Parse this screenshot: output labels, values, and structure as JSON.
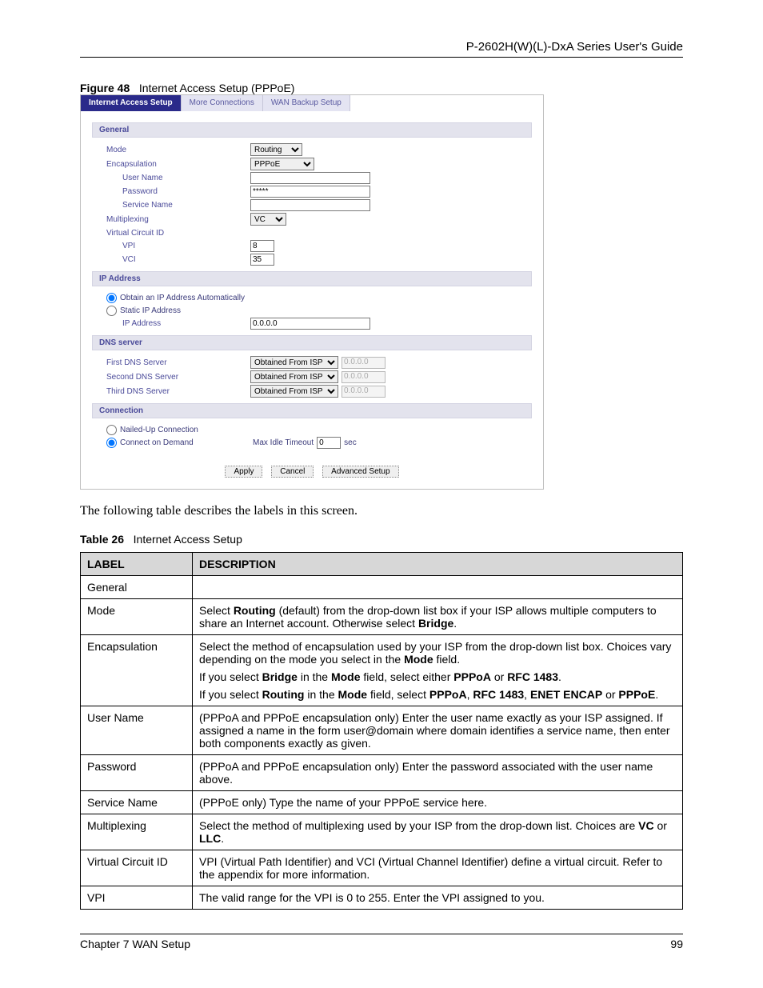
{
  "header": {
    "guide_title": "P-2602H(W)(L)-DxA Series User's Guide"
  },
  "figure": {
    "label": "Figure 48",
    "title": "Internet Access Setup (PPPoE)"
  },
  "shot": {
    "tabs": {
      "active": "Internet Access Setup",
      "t2": "More Connections",
      "t3": "WAN Backup Setup"
    },
    "general": {
      "header": "General",
      "mode_lbl": "Mode",
      "mode_val": "Routing",
      "encap_lbl": "Encapsulation",
      "encap_val": "PPPoE",
      "user_lbl": "User Name",
      "user_val": "",
      "pass_lbl": "Password",
      "pass_val": "*****",
      "service_lbl": "Service Name",
      "service_val": "",
      "mux_lbl": "Multiplexing",
      "mux_val": "VC",
      "vcid_lbl": "Virtual Circuit ID",
      "vpi_lbl": "VPI",
      "vpi_val": "8",
      "vci_lbl": "VCI",
      "vci_val": "35"
    },
    "ip": {
      "header": "IP Address",
      "auto_lbl": "Obtain an IP Address Automatically",
      "static_lbl": "Static IP Address",
      "addr_lbl": "IP Address",
      "addr_val": "0.0.0.0"
    },
    "dns": {
      "header": "DNS server",
      "d1_lbl": "First DNS Server",
      "mode": "Obtained From ISP",
      "val": "0.0.0.0",
      "d2_lbl": "Second DNS Server",
      "d3_lbl": "Third DNS Server"
    },
    "conn": {
      "header": "Connection",
      "nailed_lbl": "Nailed-Up Connection",
      "demand_lbl": "Connect on Demand",
      "idle_lbl": "Max Idle Timeout",
      "idle_val": "0",
      "idle_unit": "sec"
    },
    "buttons": {
      "apply": "Apply",
      "cancel": "Cancel",
      "adv": "Advanced Setup"
    }
  },
  "body_text": "The following table describes the labels in this screen.",
  "table_caption": {
    "label": "Table 26",
    "title": "Internet Access Setup"
  },
  "desc_table": {
    "h_label": "LABEL",
    "h_desc": "DESCRIPTION",
    "rows": [
      {
        "label": "General",
        "desc": [
          ""
        ]
      },
      {
        "label": "Mode",
        "desc": [
          "Select <b>Routing</b> (default) from the drop-down list box if your ISP allows multiple computers to share an Internet account. Otherwise select <b>Bridge</b>."
        ]
      },
      {
        "label": "Encapsulation",
        "desc": [
          "Select the method of encapsulation used by your ISP from the drop-down list box. Choices vary depending on the mode you select in the <b>Mode</b> field.",
          "If you select <b>Bridge</b> in the <b>Mode</b> field, select either <b>PPPoA</b> or <b>RFC 1483</b>.",
          "If you select <b>Routing</b> in the <b>Mode</b> field, select <b>PPPoA</b>, <b>RFC 1483</b>, <b>ENET ENCAP</b> or <b>PPPoE</b>."
        ]
      },
      {
        "label": "User Name",
        "desc": [
          "(PPPoA and PPPoE encapsulation only) Enter the user name exactly as your ISP assigned. If assigned a name in the form user@domain where domain identifies a service name, then enter both components exactly as given."
        ]
      },
      {
        "label": "Password",
        "desc": [
          "(PPPoA and PPPoE encapsulation only) Enter the password associated with the user name above."
        ]
      },
      {
        "label": "Service Name",
        "desc": [
          "(PPPoE only) Type the name of your PPPoE service here."
        ]
      },
      {
        "label": "Multiplexing",
        "desc": [
          "Select the method of multiplexing used by your ISP from the drop-down list. Choices are <b>VC</b> or <b>LLC</b>."
        ]
      },
      {
        "label": "Virtual Circuit ID",
        "desc": [
          "VPI (Virtual Path Identifier) and VCI (Virtual Channel Identifier) define a virtual circuit. Refer to the appendix for more information."
        ]
      },
      {
        "label": "VPI",
        "desc": [
          "The valid range for the VPI is 0 to 255. Enter the VPI assigned to you."
        ]
      }
    ]
  },
  "footer": {
    "chapter": "Chapter 7 WAN Setup",
    "page": "99"
  }
}
